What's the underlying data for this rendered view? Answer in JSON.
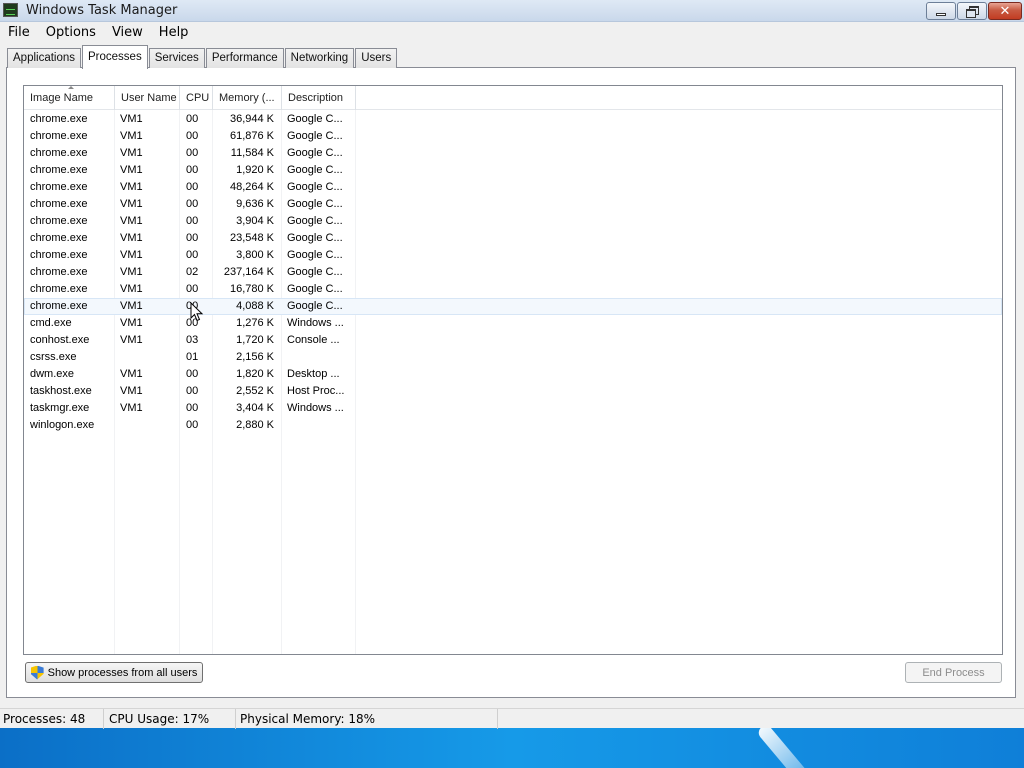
{
  "window": {
    "title": "Windows Task Manager"
  },
  "menu": [
    "File",
    "Options",
    "View",
    "Help"
  ],
  "tabs": [
    {
      "label": "Applications",
      "active": false
    },
    {
      "label": "Processes",
      "active": true
    },
    {
      "label": "Services",
      "active": false
    },
    {
      "label": "Performance",
      "active": false
    },
    {
      "label": "Networking",
      "active": false
    },
    {
      "label": "Users",
      "active": false
    }
  ],
  "columns": [
    "Image Name",
    "User Name",
    "CPU",
    "Memory (...",
    "Description"
  ],
  "processes": [
    {
      "name": "chrome.exe",
      "user": "VM1",
      "cpu": "00",
      "memory": "36,944 K",
      "description": "Google C..."
    },
    {
      "name": "chrome.exe",
      "user": "VM1",
      "cpu": "00",
      "memory": "61,876 K",
      "description": "Google C..."
    },
    {
      "name": "chrome.exe",
      "user": "VM1",
      "cpu": "00",
      "memory": "11,584 K",
      "description": "Google C..."
    },
    {
      "name": "chrome.exe",
      "user": "VM1",
      "cpu": "00",
      "memory": "1,920 K",
      "description": "Google C..."
    },
    {
      "name": "chrome.exe",
      "user": "VM1",
      "cpu": "00",
      "memory": "48,264 K",
      "description": "Google C..."
    },
    {
      "name": "chrome.exe",
      "user": "VM1",
      "cpu": "00",
      "memory": "9,636 K",
      "description": "Google C..."
    },
    {
      "name": "chrome.exe",
      "user": "VM1",
      "cpu": "00",
      "memory": "3,904 K",
      "description": "Google C..."
    },
    {
      "name": "chrome.exe",
      "user": "VM1",
      "cpu": "00",
      "memory": "23,548 K",
      "description": "Google C..."
    },
    {
      "name": "chrome.exe",
      "user": "VM1",
      "cpu": "00",
      "memory": "3,800 K",
      "description": "Google C..."
    },
    {
      "name": "chrome.exe",
      "user": "VM1",
      "cpu": "02",
      "memory": "237,164 K",
      "description": "Google C..."
    },
    {
      "name": "chrome.exe",
      "user": "VM1",
      "cpu": "00",
      "memory": "16,780 K",
      "description": "Google C..."
    },
    {
      "name": "chrome.exe",
      "user": "VM1",
      "cpu": "00",
      "memory": "4,088 K",
      "description": "Google C...",
      "hovered": true
    },
    {
      "name": "cmd.exe",
      "user": "VM1",
      "cpu": "00",
      "memory": "1,276 K",
      "description": "Windows ..."
    },
    {
      "name": "conhost.exe",
      "user": "VM1",
      "cpu": "03",
      "memory": "1,720 K",
      "description": "Console ..."
    },
    {
      "name": "csrss.exe",
      "user": "",
      "cpu": "01",
      "memory": "2,156 K",
      "description": ""
    },
    {
      "name": "dwm.exe",
      "user": "VM1",
      "cpu": "00",
      "memory": "1,820 K",
      "description": "Desktop ..."
    },
    {
      "name": "taskhost.exe",
      "user": "VM1",
      "cpu": "00",
      "memory": "2,552 K",
      "description": "Host Proc..."
    },
    {
      "name": "taskmgr.exe",
      "user": "VM1",
      "cpu": "00",
      "memory": "3,404 K",
      "description": "Windows ..."
    },
    {
      "name": "winlogon.exe",
      "user": "",
      "cpu": "00",
      "memory": "2,880 K",
      "description": ""
    }
  ],
  "buttons": {
    "show_all_users": "Show processes from all users",
    "end_process": "End Process"
  },
  "status": {
    "processes": "Processes: 48",
    "cpu_usage": "CPU Usage: 17%",
    "physical_memory": "Physical Memory: 18%"
  },
  "icons": {
    "app": "task-manager-icon",
    "show_all_users": "uac-shield-icon",
    "minimize": "minimize-icon",
    "maximize": "restore-icon",
    "close": "close-icon"
  }
}
